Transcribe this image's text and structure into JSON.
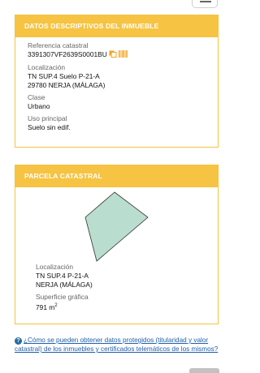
{
  "inmueble": {
    "header": "DATOS DESCRIPTIVOS DEL INMUEBLE",
    "ref_label": "Referencia catastral",
    "ref_value": "3391307VF2639S0001BU",
    "loc_label": "Localización",
    "loc_line1": "TN SUP.4 Suelo P-21-A",
    "loc_line2": "29780 NERJA (MÁLAGA)",
    "clase_label": "Clase",
    "clase_value": "Urbano",
    "uso_label": "Uso principal",
    "uso_value": "Suelo sin edif.",
    "icons": [
      "copy-icon",
      "barcode-icon"
    ]
  },
  "parcela": {
    "header": "PARCELA CATASTRAL",
    "loc_label": "Localización",
    "loc_line1": "TN SUP.4 P-21-A",
    "loc_line2": "NERJA (MÁLAGA)",
    "sup_label": "Superficie gráfica",
    "sup_value": "791 m",
    "sup_unit_sup": "2",
    "polygon_fill": "#b9ddce",
    "polygon_stroke": "#333333"
  },
  "faq": {
    "text": "¿Cómo se pueden obtener datos protegidos (titularidad y valor catastral) de los inmuebles y certificados telemáticos de los mismos?"
  },
  "colors": {
    "accent": "#f6c342",
    "link": "#1f5fa8"
  }
}
